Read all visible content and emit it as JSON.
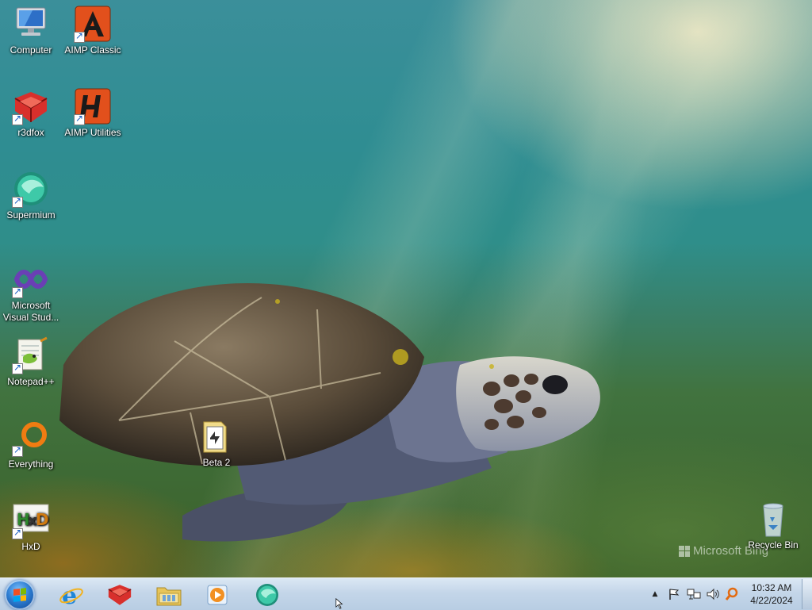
{
  "desktop": {
    "watermark": "Microsoft Bing",
    "icons": [
      {
        "label": "Computer",
        "icon": "computer-icon"
      },
      {
        "label": "AIMP Classic",
        "icon": "aimp-classic-icon"
      },
      {
        "label": "r3dfox",
        "icon": "r3dfox-icon"
      },
      {
        "label": "AIMP Utilities",
        "icon": "aimp-utilities-icon"
      },
      {
        "label": "Supermium",
        "icon": "supermium-icon"
      },
      {
        "label": "Microsoft Visual Stud...",
        "icon": "visual-studio-icon"
      },
      {
        "label": "Notepad++",
        "icon": "notepadpp-icon"
      },
      {
        "label": "Everything",
        "icon": "everything-icon"
      },
      {
        "label": "HxD",
        "icon": "hxd-icon"
      },
      {
        "label": "Beta 2",
        "icon": "folder-icon"
      },
      {
        "label": "Recycle Bin",
        "icon": "recycle-bin-icon"
      }
    ]
  },
  "taskbar": {
    "pinned": [
      {
        "name": "Internet Explorer",
        "icon": "internet-explorer-icon"
      },
      {
        "name": "r3dfox",
        "icon": "r3dfox-icon"
      },
      {
        "name": "Windows Explorer",
        "icon": "file-explorer-icon"
      },
      {
        "name": "Windows Media Player",
        "icon": "media-player-icon"
      },
      {
        "name": "Supermium",
        "icon": "supermium-icon"
      }
    ],
    "tray": {
      "icons": [
        "show-hidden-icons-arrow",
        "action-center-flag-icon",
        "network-icon",
        "volume-icon",
        "search-tool-icon"
      ],
      "time": "10:32 AM",
      "date": "4/22/2024"
    }
  },
  "colors": {
    "taskbar_top": "#dbe8f4",
    "taskbar_bottom": "#b8cde3",
    "water": "#2f8d92",
    "seaweed": "#a07820"
  }
}
